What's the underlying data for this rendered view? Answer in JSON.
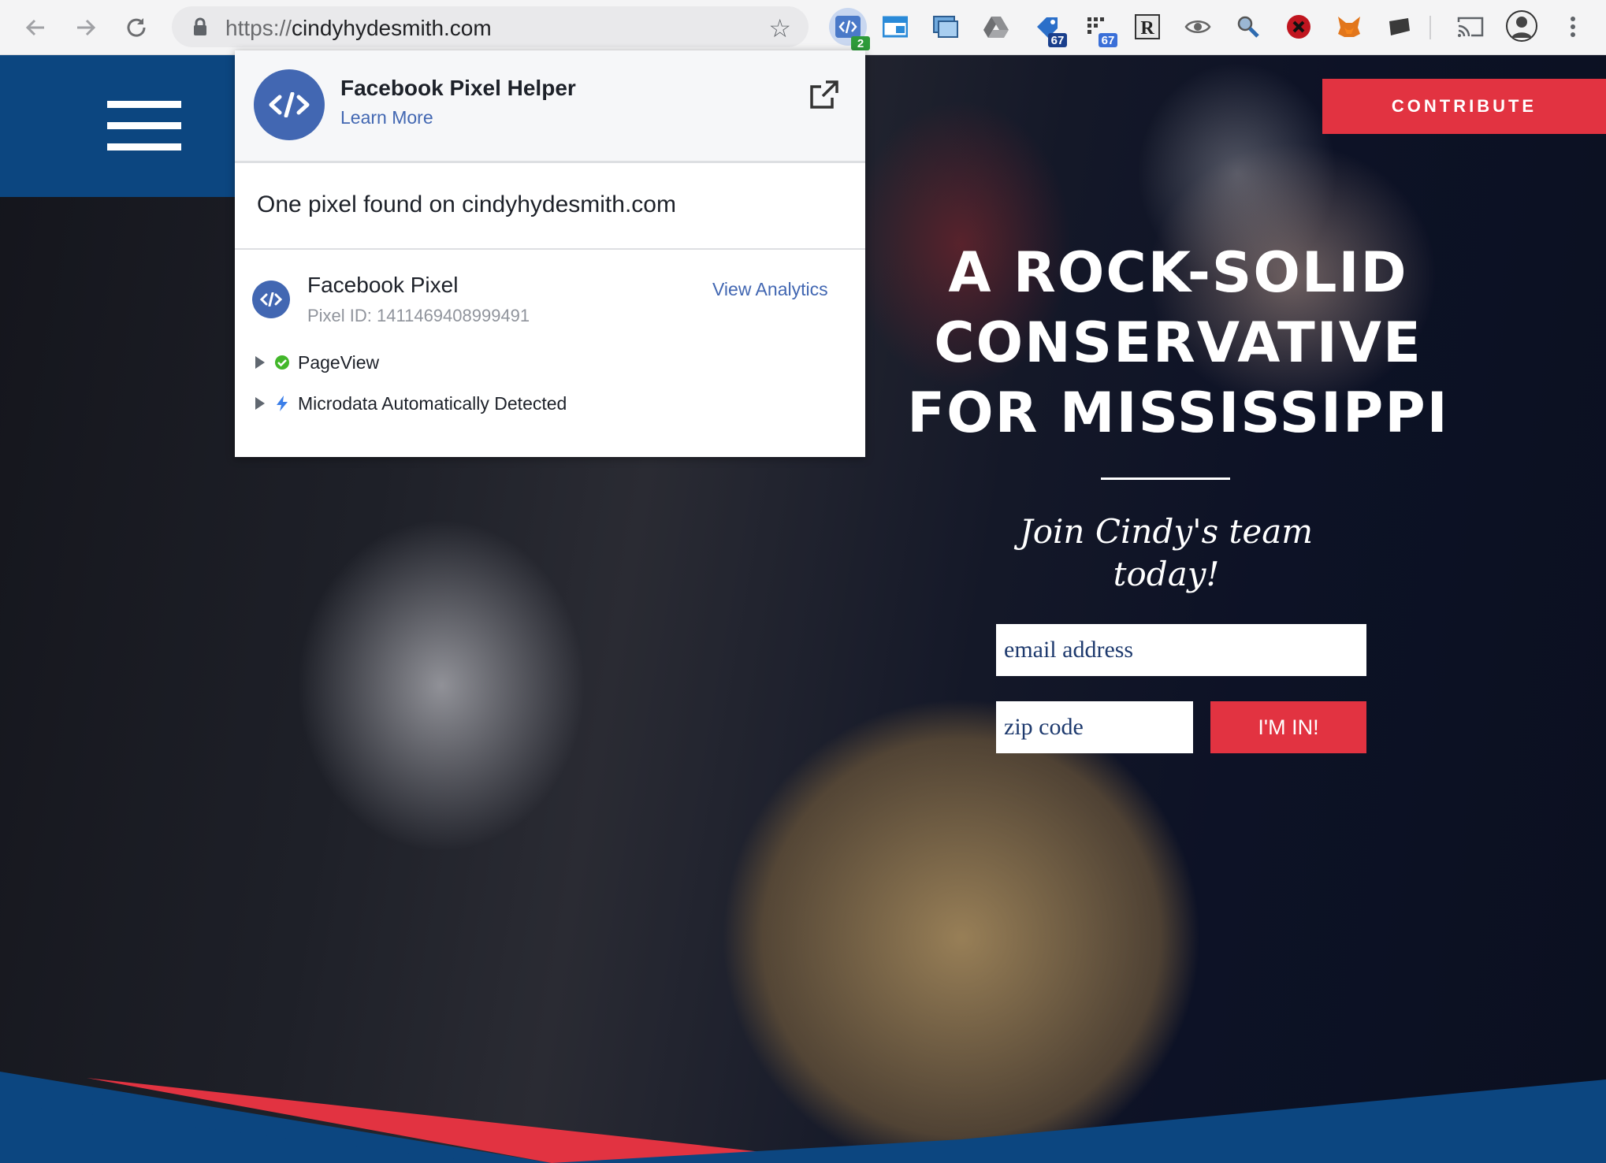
{
  "browser": {
    "url_protocol": "https://",
    "url_host": "cindyhydesmith.com",
    "extensions": [
      {
        "name": "pixel-helper-icon",
        "badge": "2",
        "badge_color": "#2e9b3a"
      },
      {
        "name": "window-icon"
      },
      {
        "name": "screenshot-icon"
      },
      {
        "name": "drive-icon"
      },
      {
        "name": "tag-icon",
        "badge": "67",
        "badge_color": "#1a3f8c"
      },
      {
        "name": "grid-icon",
        "badge": "67",
        "badge_color": "#3a6fd8"
      },
      {
        "name": "r-letter-icon"
      },
      {
        "name": "eye-icon"
      },
      {
        "name": "magnifier-icon"
      },
      {
        "name": "blocker-icon"
      },
      {
        "name": "fox-icon"
      },
      {
        "name": "note-icon"
      },
      {
        "name": "cast-icon"
      },
      {
        "name": "profile-avatar"
      },
      {
        "name": "more-vert-icon"
      }
    ]
  },
  "popup": {
    "title": "Facebook Pixel Helper",
    "learn_more": "Learn More",
    "summary": "One pixel found on cindyhydesmith.com",
    "pixel_name": "Facebook Pixel",
    "pixel_id": "Pixel ID: 1411469408999491",
    "view_analytics": "View Analytics",
    "events": [
      {
        "label": "PageView",
        "status": "success",
        "status_color": "#42b72a"
      },
      {
        "label": "Microdata Automatically Detected",
        "status": "info",
        "status_color": "#3b7ee8"
      }
    ]
  },
  "site": {
    "contribute": "CONTRIBUTE",
    "headline_lines": [
      "A ROCK-SOLID",
      "CONSERVATIVE",
      "FOR MISSISSIPPI"
    ],
    "tagline_lines": [
      "Join Cindy's team",
      "today!"
    ],
    "email_placeholder": "email address",
    "zip_placeholder": "zip code",
    "submit": "I'M IN!",
    "colors": {
      "navy": "#0c4680",
      "red": "#e23341"
    }
  }
}
